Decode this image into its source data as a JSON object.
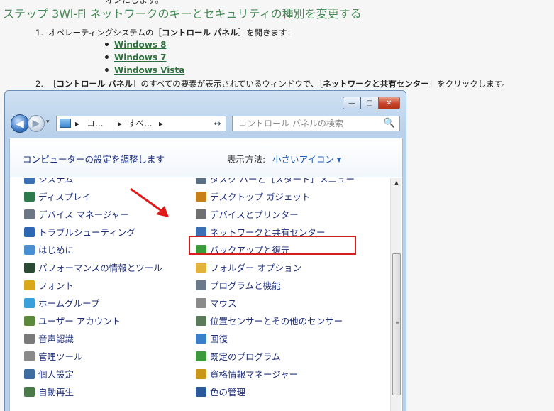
{
  "article": {
    "cut_text": "オンにします。",
    "heading": "ステップ 3Wi-Fi ネットワークのキーとセキュリティの種別を変更する",
    "step1": {
      "num": "1.",
      "pre": "オペレーティングシステムの［",
      "bold": "コントロール パネル",
      "post": "］を開きます："
    },
    "os_links": [
      "Windows 8",
      "Windows 7",
      "Windows Vista"
    ],
    "step2": {
      "num": "2.",
      "pre": "［",
      "bold1": "コントロール パネル",
      "mid": "］のすべての要素が表示されているウィンドウで、［",
      "bold2": "ネットワークと共有センター",
      "post": "］をクリックします。"
    }
  },
  "window": {
    "controls": {
      "minimize": "—",
      "maximize": "□",
      "close": "✕"
    },
    "nav": {
      "back": "◀",
      "forward": "▶",
      "history": "▾"
    },
    "address": {
      "seg1": "コ...",
      "seg2": "すべ...",
      "sep": "▸",
      "drop": "▾"
    },
    "refresh_icon": "↔",
    "search": {
      "placeholder": "コントロール パネルの検索",
      "icon": "🔍"
    },
    "subheader": {
      "title": "コンピューターの設定を調整します",
      "view_label": "表示方法:",
      "view_value": "小さいアイコン ▾"
    },
    "items_left": [
      {
        "label": "システム",
        "icon": "system-icon",
        "color": "#3a6fb5"
      },
      {
        "label": "ディスプレイ",
        "icon": "display-icon",
        "color": "#2d7a4d"
      },
      {
        "label": "デバイス マネージャー",
        "icon": "device-manager-icon",
        "color": "#6b7785"
      },
      {
        "label": "トラブルシューティング",
        "icon": "troubleshooting-icon",
        "color": "#2f66b3"
      },
      {
        "label": "はじめに",
        "icon": "getting-started-icon",
        "color": "#4a8fcf"
      },
      {
        "label": "パフォーマンスの情報とツール",
        "icon": "performance-icon",
        "color": "#2b4a35"
      },
      {
        "label": "フォント",
        "icon": "fonts-icon",
        "color": "#d9a71a"
      },
      {
        "label": "ホームグループ",
        "icon": "homegroup-icon",
        "color": "#3aa0d9"
      },
      {
        "label": "ユーザー アカウント",
        "icon": "user-accounts-icon",
        "color": "#5a8a3a"
      },
      {
        "label": "音声認識",
        "icon": "speech-icon",
        "color": "#7a7a7a"
      },
      {
        "label": "管理ツール",
        "icon": "admin-tools-icon",
        "color": "#8a8a8a"
      },
      {
        "label": "個人設定",
        "icon": "personalization-icon",
        "color": "#3c6d9c"
      },
      {
        "label": "自動再生",
        "icon": "autoplay-icon",
        "color": "#4a7a4a"
      }
    ],
    "items_right": [
      {
        "label": "タスク バーと［スタート］メニュー",
        "icon": "taskbar-icon",
        "color": "#5a6e84"
      },
      {
        "label": "デスクトップ ガジェット",
        "icon": "gadgets-icon",
        "color": "#c77f18"
      },
      {
        "label": "デバイスとプリンター",
        "icon": "devices-printers-icon",
        "color": "#707070"
      },
      {
        "label": "ネットワークと共有センター",
        "icon": "network-icon",
        "color": "#3a6fb5"
      },
      {
        "label": "バックアップと復元",
        "icon": "backup-icon",
        "color": "#3b9b3b"
      },
      {
        "label": "フォルダー オプション",
        "icon": "folder-options-icon",
        "color": "#e2b33a"
      },
      {
        "label": "プログラムと機能",
        "icon": "programs-icon",
        "color": "#6a7a8a"
      },
      {
        "label": "マウス",
        "icon": "mouse-icon",
        "color": "#8a8a8a"
      },
      {
        "label": "位置センサーとその他のセンサー",
        "icon": "sensor-icon",
        "color": "#5a7a5a"
      },
      {
        "label": "回復",
        "icon": "recovery-icon",
        "color": "#3a7fc9"
      },
      {
        "label": "既定のプログラム",
        "icon": "default-programs-icon",
        "color": "#3c9a3c"
      },
      {
        "label": "資格情報マネージャー",
        "icon": "credential-icon",
        "color": "#c9961a"
      },
      {
        "label": "色の管理",
        "icon": "color-management-icon",
        "color": "#2a5a9a"
      }
    ],
    "scroll": {
      "up": "▲",
      "grip": "≡"
    },
    "highlight_color": "#d41f1f"
  }
}
